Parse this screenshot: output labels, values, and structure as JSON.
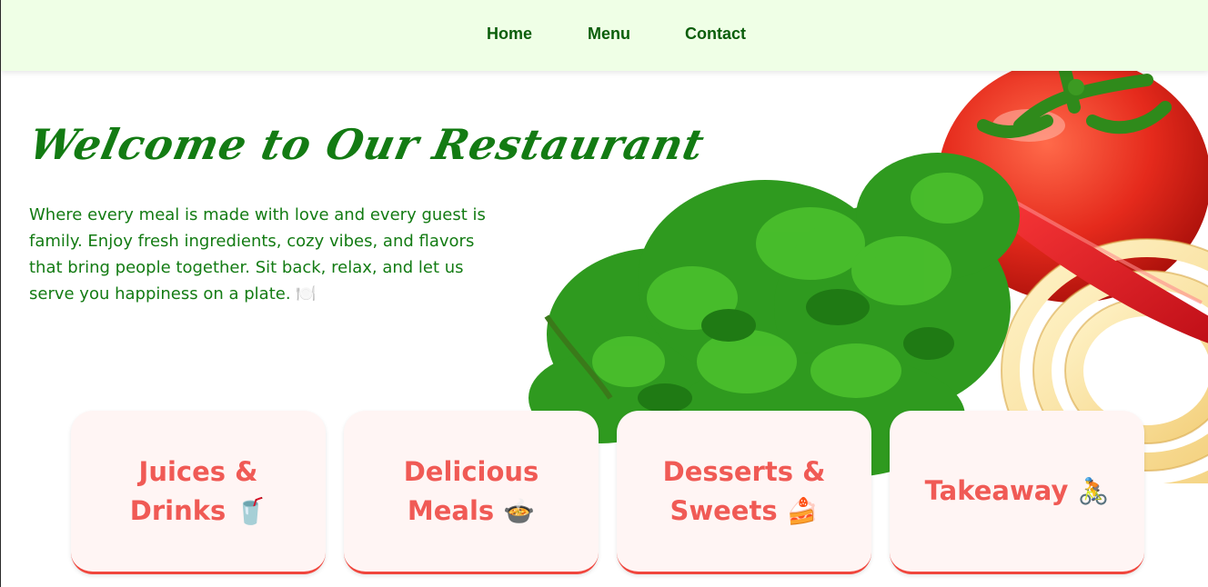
{
  "nav": {
    "items": [
      {
        "label": "Home"
      },
      {
        "label": "Menu"
      },
      {
        "label": "Contact"
      }
    ]
  },
  "hero": {
    "title": "Welcome to Our Restaurant",
    "description": "Where every meal is made with love and every guest is family. Enjoy fresh ingredients, cozy vibes, and flavors that bring people together. Sit back, relax, and let us serve you happiness on a plate. 🍽️"
  },
  "cards": [
    {
      "label": "Juices & Drinks",
      "icon": "🥤",
      "icon_name": "cup-with-straw-icon"
    },
    {
      "label": "Delicious Meals",
      "icon": "🍲",
      "icon_name": "pot-of-food-icon"
    },
    {
      "label": "Desserts & Sweets",
      "icon": "🍰",
      "icon_name": "shortcake-icon"
    },
    {
      "label": "Takeaway",
      "icon": "🚴",
      "icon_name": "bicyclist-icon"
    }
  ],
  "colors": {
    "nav_bg": "#efffe6",
    "nav_text": "#0b5e0b",
    "hero_text": "#137b13",
    "card_bg": "#fff5f4",
    "card_text": "#f05a55",
    "card_border": "#f0463d"
  }
}
